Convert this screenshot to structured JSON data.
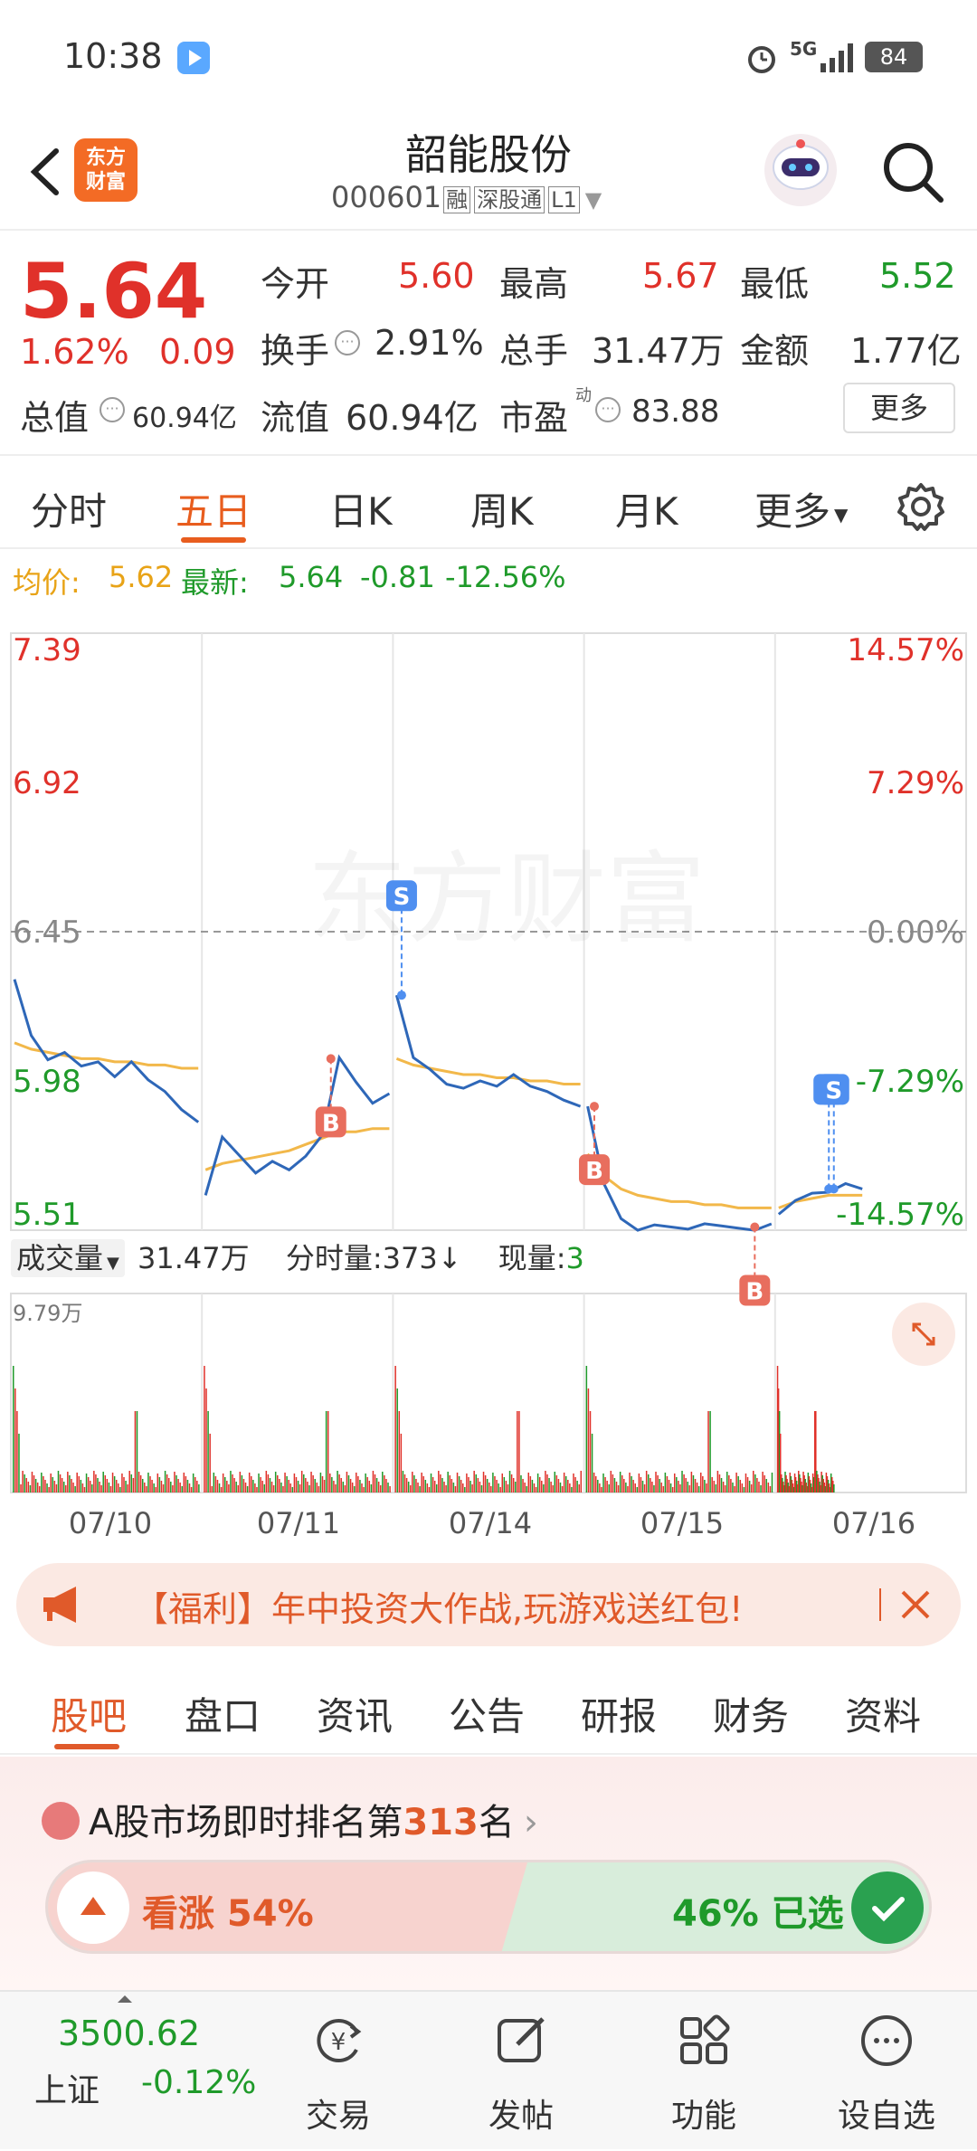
{
  "status_bar": {
    "time": "10:38",
    "network": "5G",
    "battery": "84"
  },
  "header": {
    "title": "韶能股份",
    "code": "000601",
    "tags": [
      "融",
      "深股通",
      "L1"
    ],
    "brand": [
      "东方",
      "财富"
    ]
  },
  "quote": {
    "price": "5.64",
    "change_pct": "1.62%",
    "change": "0.09",
    "open_label": "今开",
    "open": "5.60",
    "high_label": "最高",
    "high": "5.67",
    "low_label": "最低",
    "low": "5.52",
    "turnover_label": "换手",
    "turnover": "2.91%",
    "volume_label": "总手",
    "volume": "31.47万",
    "amount_label": "金额",
    "amount": "1.77亿",
    "mktcap_label": "总值",
    "mktcap": "60.94亿",
    "float_label": "流值",
    "float": "60.94亿",
    "pe_label": "市盈",
    "pe_sup": "动",
    "pe": "83.88",
    "more_button": "更多"
  },
  "period_tabs": [
    {
      "label": "分时"
    },
    {
      "label": "五日",
      "active": true
    },
    {
      "label": "日K"
    },
    {
      "label": "周K"
    },
    {
      "label": "月K"
    },
    {
      "label": "更多"
    }
  ],
  "chart_info": {
    "avg_label": "均价:",
    "avg": "5.62",
    "latest_label": "最新:",
    "latest": "5.64",
    "delta": "-0.81",
    "delta_pct": "-12.56%"
  },
  "chart_data": {
    "type": "line",
    "y_labels_left": [
      "7.39",
      "6.92",
      "6.45",
      "5.98",
      "5.51"
    ],
    "y_labels_right": [
      "14.57%",
      "7.29%",
      "0.00%",
      "-7.29%",
      "-14.57%"
    ],
    "ylim": [
      5.51,
      7.39
    ],
    "baseline": 6.45,
    "x_labels": [
      "07/10",
      "07/11",
      "07/14",
      "07/15",
      "07/16"
    ],
    "watermark": "东方财富",
    "series": [
      {
        "day": "07/10",
        "price_points": [
          6.3,
          6.12,
          6.05,
          6.08,
          6.02,
          6.04,
          6.0,
          6.03,
          5.98,
          5.95,
          5.9,
          5.85
        ],
        "avg_points": [
          6.1,
          6.08,
          6.07,
          6.06,
          6.05,
          6.05,
          6.04,
          6.04,
          6.03,
          6.03,
          6.02,
          6.02
        ]
      },
      {
        "day": "07/11",
        "price_points": [
          5.62,
          5.8,
          5.75,
          5.7,
          5.72,
          5.7,
          5.75,
          5.8,
          6.05,
          5.98,
          5.92,
          5.94
        ],
        "avg_points": [
          5.7,
          5.72,
          5.73,
          5.74,
          5.75,
          5.76,
          5.78,
          5.8,
          5.82,
          5.82,
          5.83,
          5.83
        ]
      },
      {
        "day": "07/14",
        "price_points": [
          6.25,
          6.05,
          6.02,
          5.98,
          5.95,
          5.98,
          5.97,
          5.99,
          5.96,
          5.95,
          5.93,
          5.9
        ],
        "avg_points": [
          6.05,
          6.03,
          6.02,
          6.01,
          6.0,
          6.0,
          5.99,
          5.99,
          5.98,
          5.98,
          5.97,
          5.97
        ]
      },
      {
        "day": "07/15",
        "price_points": [
          5.9,
          5.65,
          5.55,
          5.52,
          5.52,
          5.52,
          5.52,
          5.52,
          5.52,
          5.52,
          5.52,
          5.53
        ],
        "avg_points": [
          5.75,
          5.68,
          5.64,
          5.62,
          5.61,
          5.6,
          5.6,
          5.59,
          5.59,
          5.58,
          5.58,
          5.58
        ]
      },
      {
        "day": "07/16",
        "price_points": [
          5.56,
          5.6,
          5.63,
          5.64,
          5.65,
          5.64
        ],
        "avg_points": [
          5.58,
          5.6,
          5.61,
          5.62,
          5.62,
          5.62
        ]
      }
    ],
    "markers": [
      {
        "label": "B",
        "day": 1,
        "pos": 7.5
      },
      {
        "label": "S",
        "day": 2,
        "pos": 0.3
      },
      {
        "label": "B",
        "day": 3,
        "pos": 0.4
      },
      {
        "label": "B",
        "day": 3,
        "pos": 10
      },
      {
        "label": "S",
        "day": 4,
        "pos": 3.0
      },
      {
        "label": "S",
        "day": 4,
        "pos": 3.3
      }
    ],
    "volume": {
      "label": "成交量",
      "total": "31.47万",
      "tick_label": "分时量:373",
      "now_label": "现量:",
      "now": "3",
      "max_label": "9.79万"
    }
  },
  "banner": {
    "text": "【福利】年中投资大作战,玩游戏送红包!"
  },
  "guba_tabs": [
    {
      "label": "股吧",
      "active": true
    },
    {
      "label": "盘口"
    },
    {
      "label": "资讯"
    },
    {
      "label": "公告"
    },
    {
      "label": "研报"
    },
    {
      "label": "财务"
    },
    {
      "label": "资料"
    }
  ],
  "rank": {
    "prefix": "A股市场即时排名第",
    "number": "313",
    "suffix": "名",
    "up_label": "看涨 54%",
    "down_label": "46% 已选"
  },
  "bottom_bar": {
    "index_value": "3500.62",
    "index_name": "上证",
    "index_change": "-0.12%",
    "items": [
      {
        "label": "交易"
      },
      {
        "label": "发帖"
      },
      {
        "label": "功能"
      },
      {
        "label": "设自选"
      }
    ]
  }
}
